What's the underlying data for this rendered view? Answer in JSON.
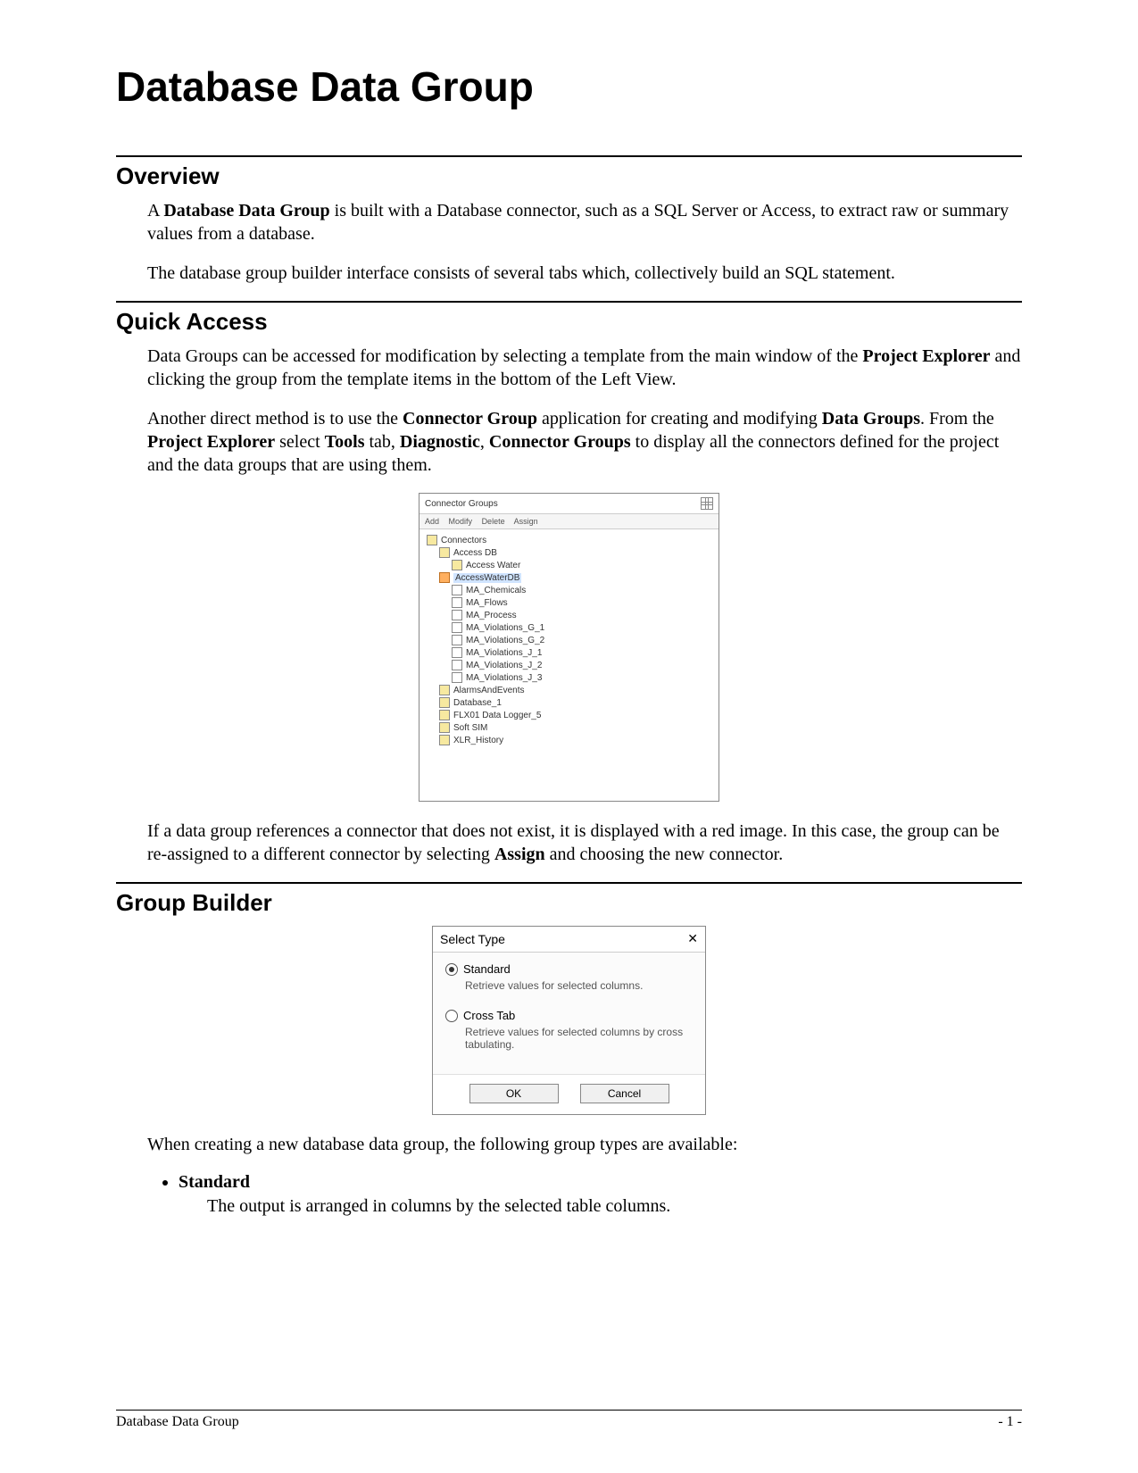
{
  "title": "Database Data Group",
  "sections": {
    "overview": {
      "heading": "Overview",
      "p1_pre": "A ",
      "p1_bold": "Database Data Group",
      "p1_post": " is built with a Database connector, such as a SQL Server or Access, to extract raw or summary values from a database.",
      "p2": "The database group builder interface consists of several tabs which, collectively build an SQL statement."
    },
    "quick_access": {
      "heading": "Quick Access",
      "p1_pre": "Data Groups can be accessed for modification by selecting a template from the main window of the ",
      "p1_bold": "Project Explorer",
      "p1_post": " and clicking the group from the template items in the bottom of the Left View.",
      "p2_a": "Another direct method is to use the ",
      "p2_b": "Connector Group",
      "p2_c": " application for creating and modifying ",
      "p2_d": "Data Groups",
      "p2_e": ".  From the ",
      "p2_f": "Project Explorer",
      "p2_g": " select ",
      "p2_h": "Tools",
      "p2_i": " tab, ",
      "p2_j": "Diagnostic",
      "p2_k": ", ",
      "p2_l": "Connector Groups",
      "p2_m": " to display all the connectors defined for the project and the data groups that are using them.",
      "p3_a": "If a data group references a connector that does not exist, it is displayed with a red image.  In this case, the group can be re-assigned to a different connector by selecting ",
      "p3_b": "Assign",
      "p3_c": " and choosing the new connector."
    },
    "group_builder": {
      "heading": "Group Builder",
      "p1": "When creating a new database data group, the following group types are available:",
      "bullet1_label": "Standard",
      "bullet1_desc": "The output is arranged in columns by the selected table columns."
    }
  },
  "cg_window": {
    "title": "Connector Groups",
    "toolbar": {
      "add": "Add",
      "modify": "Modify",
      "delete": "Delete",
      "assign": "Assign"
    },
    "tree": {
      "root": "Connectors",
      "items": [
        "Access DB",
        "Access Water",
        "AccessWaterDB",
        "MA_Chemicals",
        "MA_Flows",
        "MA_Process",
        "MA_Violations_G_1",
        "MA_Violations_G_2",
        "MA_Violations_J_1",
        "MA_Violations_J_2",
        "MA_Violations_J_3",
        "AlarmsAndEvents",
        "Database_1",
        "FLX01 Data Logger_5",
        "Soft SIM",
        "XLR_History"
      ],
      "selected_index": 2
    }
  },
  "st_dialog": {
    "title": "Select Type",
    "opt1": {
      "label": "Standard",
      "desc": "Retrieve values for selected columns."
    },
    "opt2": {
      "label": "Cross Tab",
      "desc": "Retrieve values for selected columns by cross tabulating."
    },
    "ok": "OK",
    "cancel": "Cancel"
  },
  "footer": {
    "left": "Database Data Group",
    "right": "- 1 -"
  }
}
